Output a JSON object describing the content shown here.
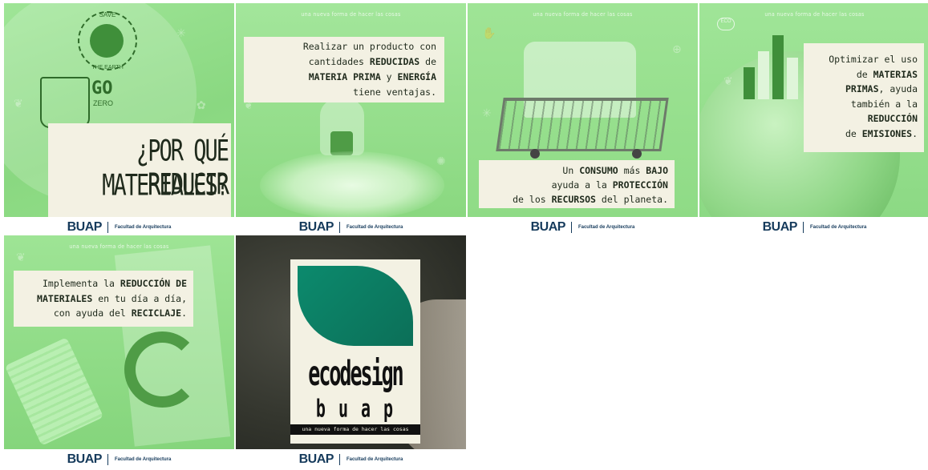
{
  "tagline": "una nueva forma de hacer las cosas",
  "footer": {
    "brand": "BUAP",
    "faculty": "Facultad de Arquitectura"
  },
  "tiles": [
    {
      "badge_top": "SAVE",
      "badge_bottom": "THE EARTH",
      "cup_text": "GO",
      "cup_text2": "ZERO",
      "headline_1": "¿POR QUÉ REDUCIR",
      "headline_2": "MATERIALES?"
    },
    {
      "line1": "Realizar un producto con",
      "line2a": "cantidades ",
      "line2b": "REDUCIDAS",
      "line2c": " de",
      "line3a": "MATERIA PRIMA",
      "line3b": " y ",
      "line3c": "ENERGÍA",
      "line4": "tiene ventajas."
    },
    {
      "line1a": "Un ",
      "line1b": "CONSUMO",
      "line1c": " más ",
      "line1d": "BAJO",
      "line2a": "ayuda a la ",
      "line2b": "PROTECCIÓN",
      "line3a": "de los ",
      "line3b": "RECURSOS",
      "line3c": " del planeta."
    },
    {
      "badge": "ECO",
      "line1": "Optimizar el uso",
      "line2a": "de ",
      "line2b": "MATERIAS",
      "line3a": "PRIMAS",
      "line3b": ", ayuda",
      "line4": "también a la",
      "line5": "REDUCCIÓN",
      "line6a": "de ",
      "line6b": "EMISIONES",
      "line6c": "."
    },
    {
      "line1a": "Implementa la ",
      "line1b": "REDUCCIÓN DE",
      "line2a": "MATERIALES",
      "line2b": " en tu día a día,",
      "line3a": "con ayuda del ",
      "line3b": "RECICLAJE",
      "line3c": "."
    },
    {
      "word1": "ecodesign",
      "word2": "buap",
      "subtitle": "una nueva forma de hacer las cosas"
    }
  ],
  "colors": {
    "green_bg": "#93e08a",
    "green_dark": "#4fae49",
    "cream": "#f3f1e3",
    "teal": "#0e8a70",
    "navy": "#163b5c"
  }
}
